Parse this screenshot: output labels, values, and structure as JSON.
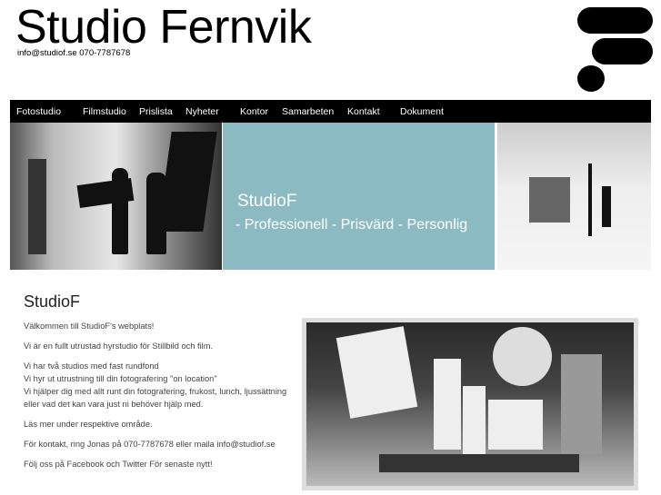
{
  "header": {
    "title": "Studio Fernvik",
    "contact": "info@studiof.se  070-7787678"
  },
  "nav": {
    "items": [
      "Fotostudio",
      "Filmstudio",
      "Prislista",
      "Nyheter",
      "Kontor",
      "Samarbeten",
      "Kontakt",
      "Dokument"
    ]
  },
  "banner": {
    "title": "StudioF",
    "subtitle": "- Professionell - Prisvärd - Personlig",
    "color": "#8cbac3"
  },
  "main": {
    "heading": "StudioF",
    "paragraphs": [
      "Välkommen till StudioF's webplats!",
      "Vi är en fullt utrustad hyrstudio för Stillbild och film.",
      "Vi har två studios med fast rundfond",
      "Vi hyr ut utrustning till din fotografering \"on location\"",
      "Vi hjälper dig med allt runt din fotografering, frukost, lunch, ljussättning eller vad det kan vara just ni behöver hjälp med.",
      "Läs mer under respektive område.",
      "För kontakt, ring Jonas på 070-7787678 eller maila info@studiof.se",
      "Följ oss på Facebook och Twitter För senaste nytt!"
    ]
  }
}
